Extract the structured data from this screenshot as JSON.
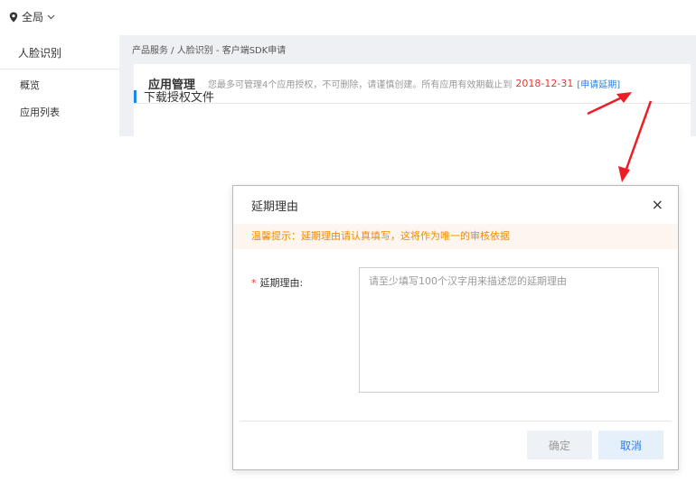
{
  "top": {
    "region_label": "全局"
  },
  "sidebar": {
    "title": "人脸识别",
    "items": [
      {
        "label": "概览"
      },
      {
        "label": "应用列表"
      }
    ]
  },
  "breadcrumb": "产品服务 / 人脸识别 - 客户端SDK申请",
  "panel": {
    "title": "应用管理",
    "notice": "您最多可管理4个应用授权，不可删除，请谨慎创建。所有应用有效期截止到",
    "expiry_date": "2018-12-31",
    "extend_link": "[申请延期]"
  },
  "section": {
    "title": "下载授权文件"
  },
  "modal": {
    "title": "延期理由",
    "close_glyph": "×",
    "tip": "温馨提示：延期理由请认真填写，这将作为唯一的审核依据",
    "field_required_mark": "*",
    "field_label": "延期理由:",
    "field_value": "",
    "field_placeholder": "请至少填写100个汉字用来描述您的延期理由",
    "confirm_label": "确定",
    "cancel_label": "取消"
  },
  "colors": {
    "accent": "#2b7de9",
    "warning_text": "#f08c00",
    "annotation_arrow": "#ee1c25",
    "expiry_text": "#e53935"
  }
}
